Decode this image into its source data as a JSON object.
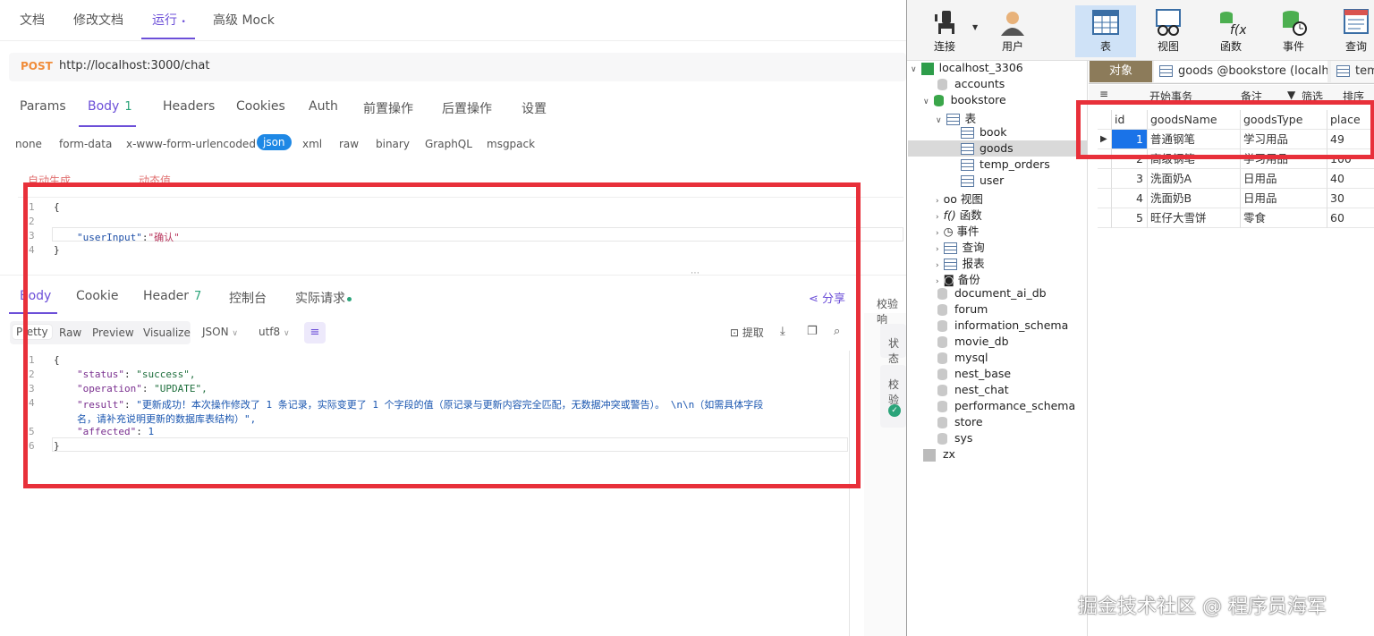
{
  "doc_tabs": [
    "文档",
    "修改文档",
    "运行",
    "高级 Mock"
  ],
  "request": {
    "method": "POST",
    "url": "http://localhost:3000/chat"
  },
  "req_tabs": [
    "Params",
    "Body",
    "Headers",
    "Cookies",
    "Auth",
    "前置操作",
    "后置操作",
    "设置"
  ],
  "body_badge": "1",
  "body_types": [
    "none",
    "form-data",
    "x-www-form-urlencoded",
    "json",
    "xml",
    "raw",
    "binary",
    "GraphQL",
    "msgpack"
  ],
  "faded_actions": [
    "自动生成",
    "动态值"
  ],
  "request_body": {
    "line_numbers": [
      "1",
      "2",
      "3",
      "4"
    ],
    "open": "{",
    "key": "\"userInput\"",
    "sep": ":",
    "value": "\"确认\"",
    "close": "}"
  },
  "resp_tabs": [
    "Body",
    "Cookie",
    "Header",
    "控制台",
    "实际请求"
  ],
  "header_badge": "7",
  "share_label": "分享",
  "resp_toolbar": {
    "segments": [
      "Pretty",
      "Raw",
      "Preview",
      "Visualize"
    ],
    "format": "JSON",
    "encoding": "utf8",
    "extract": "提取"
  },
  "response": {
    "line_numbers": [
      "1",
      "2",
      "3",
      "4",
      "",
      "5",
      "6"
    ],
    "open": "{",
    "status_key": "\"status\"",
    "status_val": "\"success\",",
    "operation_key": "\"operation\"",
    "operation_val": "\"UPDATE\",",
    "result_key": "\"result\"",
    "result_val_1": "\"更新成功！本次操作修改了 1 条记录，实际变更了 1 个字段的值（原记录与更新内容完全匹配，无数据冲突或警告）。  \\n\\n（如需具体字段",
    "result_val_2": "名，请补充说明更新的数据库表结构）\",",
    "affected_key": "\"affected\"",
    "affected_val": "1",
    "close": "}"
  },
  "side_panel": {
    "title": "校验响",
    "row1": "状态",
    "row2": "校验"
  },
  "toolbar": [
    "连接",
    "用户",
    "表",
    "视图",
    "函数",
    "事件",
    "查询"
  ],
  "tree": {
    "connection": "localhost_3306",
    "db_accounts": "accounts",
    "db_bookstore": "bookstore",
    "tables_label": "表",
    "tables": [
      "book",
      "goods",
      "temp_orders",
      "user"
    ],
    "groups": [
      "视图",
      "函数",
      "事件",
      "查询",
      "报表",
      "备份"
    ],
    "databases": [
      "document_ai_db",
      "forum",
      "information_schema",
      "movie_db",
      "mysql",
      "nest_base",
      "nest_chat",
      "performance_schema",
      "store",
      "sys"
    ],
    "conn2": "zx"
  },
  "object_tabs": [
    "对象",
    "goods @bookstore (localh...",
    "temp"
  ],
  "obj_toolbar": [
    "开始事务",
    "备注",
    "筛选",
    "排序"
  ],
  "grid": {
    "columns": [
      "id",
      "goodsName",
      "goodsType",
      "place"
    ],
    "rows": [
      [
        "1",
        "普通钢笔",
        "学习用品",
        "49"
      ],
      [
        "2",
        "高级钢笔",
        "学习用品",
        "100"
      ],
      [
        "3",
        "洗面奶A",
        "日用品",
        "40"
      ],
      [
        "4",
        "洗面奶B",
        "日用品",
        "30"
      ],
      [
        "5",
        "旺仔大雪饼",
        "零食",
        "60"
      ]
    ]
  },
  "watermark": "掘金技术社区 @ 程序员海军",
  "colors": {
    "accent": "#6c4fd8",
    "highlight_box": "#e8303a",
    "json_chip": "#1e88e5",
    "selected_row": "#1a73e8"
  }
}
